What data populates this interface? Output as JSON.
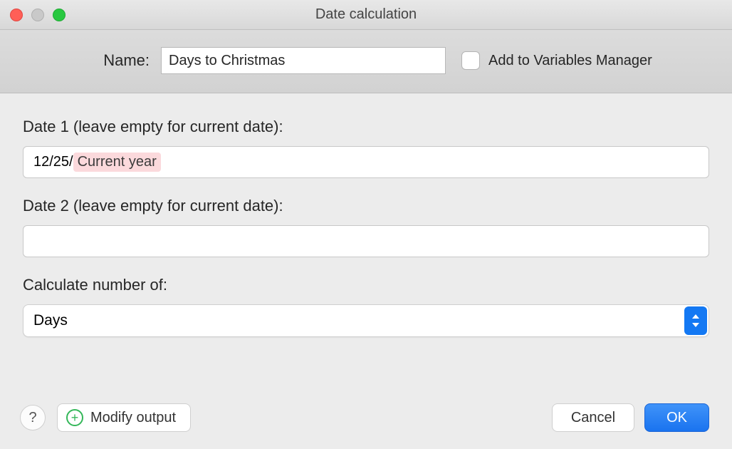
{
  "window": {
    "title": "Date calculation"
  },
  "header": {
    "name_label": "Name:",
    "name_value": "Days to Christmas",
    "add_to_vars_label": "Add to Variables Manager",
    "add_to_vars_checked": false
  },
  "fields": {
    "date1": {
      "label": "Date 1 (leave empty for current date):",
      "prefix": "12/25/",
      "token": "Current year"
    },
    "date2": {
      "label": "Date 2 (leave empty for current date):",
      "value": ""
    },
    "calc": {
      "label": "Calculate number of:",
      "selected": "Days"
    }
  },
  "footer": {
    "help": "?",
    "modify": "Modify output",
    "cancel": "Cancel",
    "ok": "OK"
  }
}
